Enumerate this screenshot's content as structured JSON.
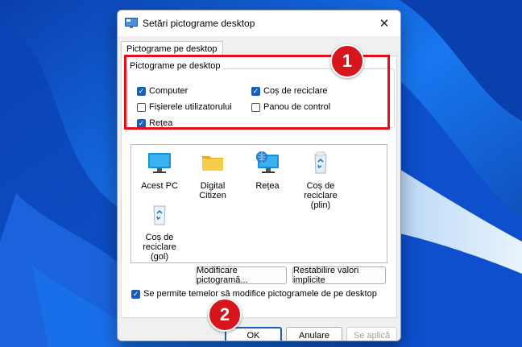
{
  "dialog": {
    "title": "Setări pictograme desktop",
    "tab_label": "Pictograme pe desktop",
    "group_label": "Pictograme pe desktop",
    "checkboxes": [
      {
        "label": "Computer",
        "checked": true
      },
      {
        "label": "Coș de reciclare",
        "checked": true
      },
      {
        "label": "Fișierele utilizatorului",
        "checked": false
      },
      {
        "label": "Panou de control",
        "checked": false
      },
      {
        "label": "Rețea",
        "checked": true
      }
    ],
    "icons": [
      {
        "label": "Acest PC",
        "icon": "monitor-icon"
      },
      {
        "label": "Digital Citizen",
        "icon": "folder-icon"
      },
      {
        "label": "Rețea",
        "icon": "network-icon"
      },
      {
        "label": "Coș de reciclare (plin)",
        "icon": "recycle-bin-full-icon"
      },
      {
        "label": "Coș de reciclare (gol)",
        "icon": "recycle-bin-empty-icon"
      }
    ],
    "change_icon_button": "Modificare pictogramă...",
    "restore_default_button": "Restabilire valori implicite",
    "allow_themes_label": "Se permite temelor să modifice pictogramele de pe desktop",
    "allow_themes_checked": true,
    "ok_button": "OK",
    "cancel_button": "Anulare",
    "apply_button": "Se aplică"
  },
  "annotations": {
    "badge_1": "1",
    "badge_2": "2",
    "accent": "#d7151d"
  },
  "colors": {
    "checkbox_accent": "#1a5fb4"
  }
}
